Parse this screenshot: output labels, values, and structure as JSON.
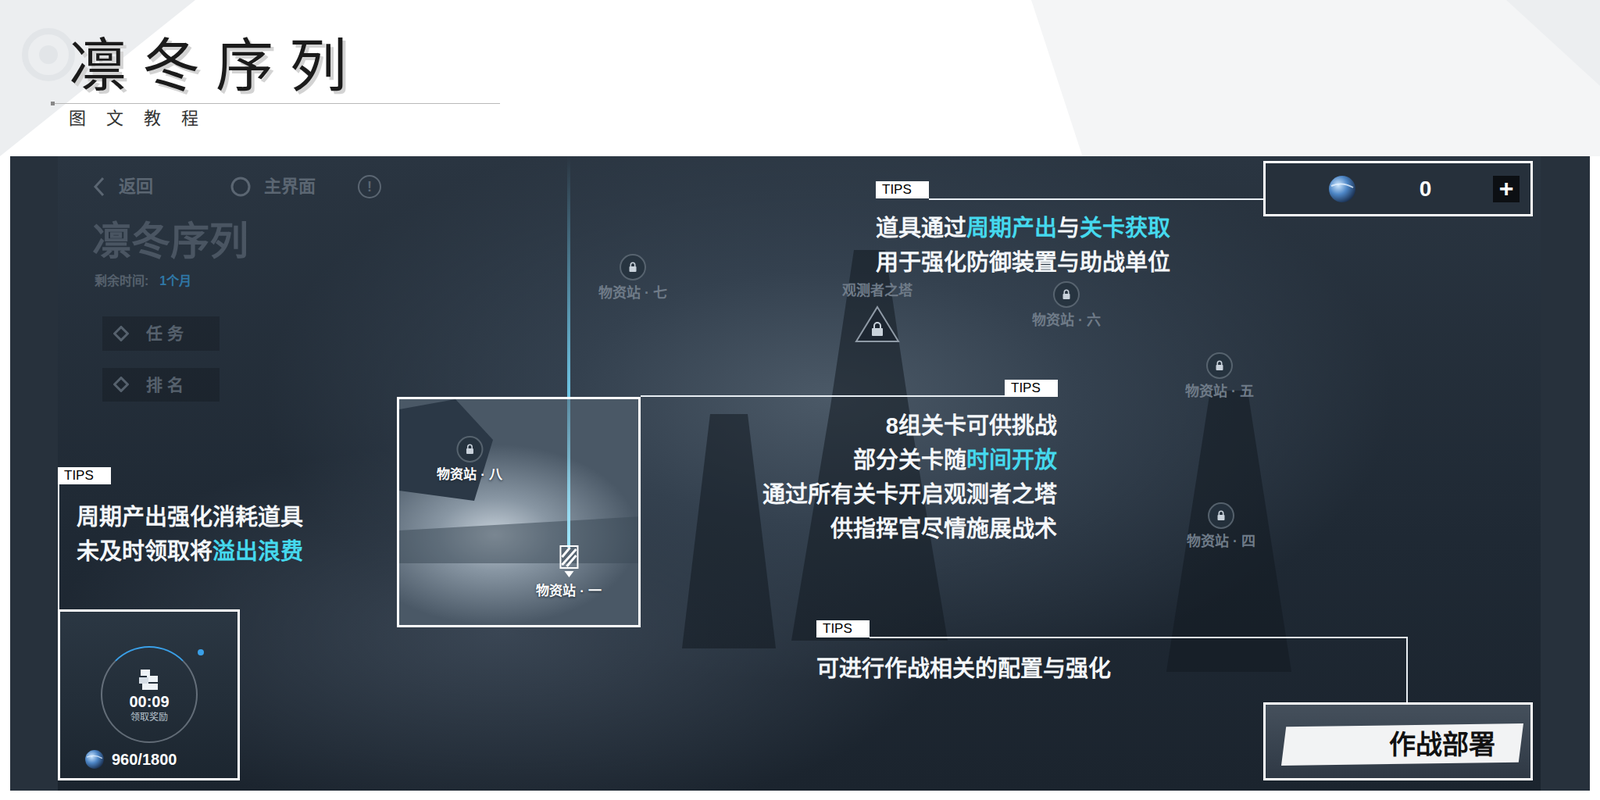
{
  "slide": {
    "title": "凛冬序列",
    "subtitle": "图 文 教 程"
  },
  "screen": {
    "nav": {
      "back": "返回",
      "home": "主界面",
      "info": "!"
    },
    "event": {
      "title": "凛冬序列",
      "remaining_label": "剩余时间:",
      "remaining": "1个月"
    },
    "menu": [
      {
        "label": "任 务"
      },
      {
        "label": "排 名"
      }
    ],
    "map_nodes": [
      {
        "label": "物资站 · 七",
        "kind": "station",
        "locked": true
      },
      {
        "label": "观测者之塔",
        "kind": "tower",
        "locked": true
      },
      {
        "label": "物资站 · 六",
        "kind": "station",
        "locked": true
      },
      {
        "label": "物资站 · 五",
        "kind": "station",
        "locked": true
      },
      {
        "label": "物资站 · 四",
        "kind": "station",
        "locked": true
      }
    ]
  },
  "tips": [
    {
      "label": "TIPS",
      "lines": [
        [
          {
            "text": "道具通过",
            "highlight": false
          },
          {
            "text": "周期产出",
            "highlight": true
          },
          {
            "text": "与",
            "highlight": false
          },
          {
            "text": "关卡获取",
            "highlight": true
          }
        ],
        [
          {
            "text": "用于强化防御装置与助战单位",
            "highlight": false
          }
        ]
      ]
    },
    {
      "label": "TIPS",
      "lines": [
        [
          {
            "text": "8组关卡可供挑战",
            "highlight": false
          }
        ],
        [
          {
            "text": "部分关卡随",
            "highlight": false
          },
          {
            "text": "时间开放",
            "highlight": true
          }
        ],
        [
          {
            "text": "通过所有关卡开启观测者之塔",
            "highlight": false
          }
        ],
        [
          {
            "text": "供指挥官尽情施展战术",
            "highlight": false
          }
        ]
      ]
    },
    {
      "label": "TIPS",
      "lines": [
        [
          {
            "text": "周期产出强化消耗道具",
            "highlight": false
          }
        ],
        [
          {
            "text": "未及时领取将",
            "highlight": false
          },
          {
            "text": "溢出浪费",
            "highlight": true
          }
        ]
      ]
    },
    {
      "label": "TIPS",
      "lines": [
        [
          {
            "text": "可进行作战相关的配置与强化",
            "highlight": false
          }
        ]
      ]
    }
  ],
  "currency": {
    "amount": "0",
    "add": "+"
  },
  "preview": {
    "nodes": [
      {
        "label": "物资站 · 八",
        "kind": "station",
        "locked": true
      },
      {
        "label": "物资站 · 一",
        "kind": "current",
        "locked": false
      }
    ]
  },
  "reward": {
    "timer": "00:09",
    "action": "领取奖励",
    "stock": "960/1800"
  },
  "deploy": {
    "label": "作战部署"
  }
}
